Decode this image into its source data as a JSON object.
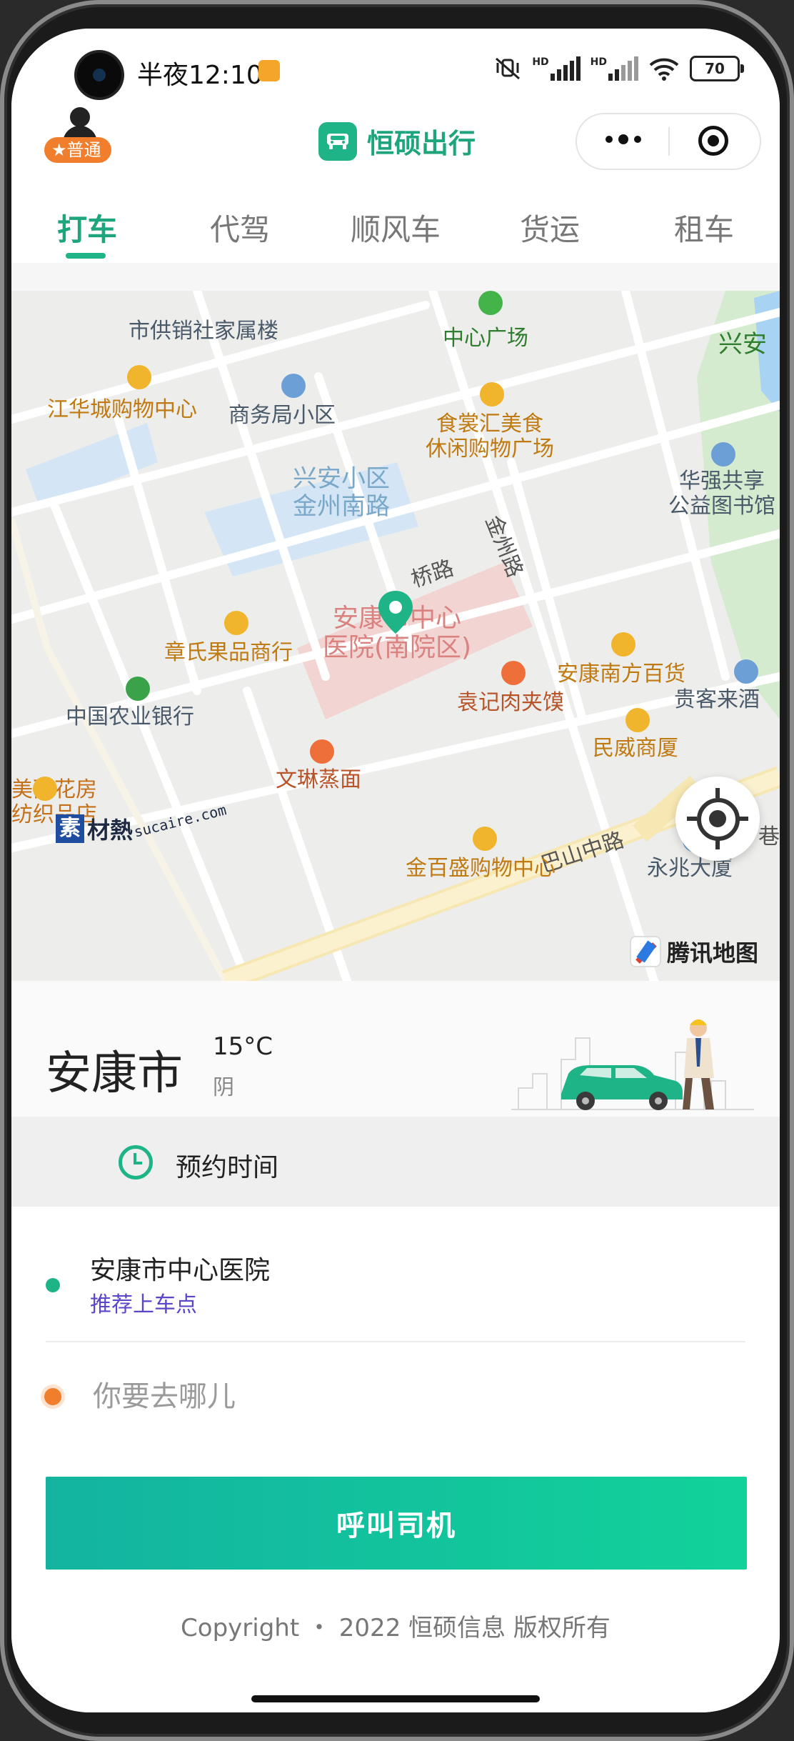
{
  "status_bar": {
    "time": "半夜12:10",
    "network_1": "HD",
    "network_2": "HD",
    "battery": "70",
    "icons": [
      "mute-vibrate-icon",
      "signal-icon",
      "signal-icon",
      "wifi-icon",
      "battery-icon"
    ]
  },
  "header": {
    "user_level": "★普通",
    "app_name": "恒硕出行",
    "more_icon": "more-dots-icon",
    "close_icon": "target-icon"
  },
  "tabs": [
    {
      "label": "打车",
      "active": true
    },
    {
      "label": "代驾",
      "active": false
    },
    {
      "label": "顺风车",
      "active": false
    },
    {
      "label": "货运",
      "active": false
    },
    {
      "label": "租车",
      "active": false
    }
  ],
  "map": {
    "pois": {
      "p1": "市供销社家属楼",
      "p2": "中心广场",
      "p3": "兴安",
      "p4": "江华城购物中心",
      "p5": "商务局小区",
      "p6": "食裳汇美食\n休闲购物广场",
      "p7": "华强共享\n公益图书馆",
      "p8": "兴安小区\n金州南路",
      "p9": "金州路",
      "p10": "桥路",
      "p11": "章氏果品商行",
      "p12": "安康市中心\n医院(南院区)",
      "p13": "安康南方百货",
      "p14": "贵客来酒",
      "p15": "中国农业银行",
      "p16": "袁记肉夹馍",
      "p17": "民威商厦",
      "p18": "美丽花房\n纺织品店",
      "p19": "文琳蒸面",
      "p20": "巴山中路",
      "p21": "金百盛购物中心",
      "p22": "永兆大厦",
      "p23": "巷"
    },
    "provider": "腾讯地图",
    "watermark_seal": "素",
    "watermark_text": "材熱",
    "watermark_url": "sucaire.com"
  },
  "weather": {
    "city": "安康市",
    "temperature": "15°C",
    "condition": "阴"
  },
  "booking": {
    "reserve_label": "预约时间",
    "pickup_title": "安康市中心医院",
    "pickup_sub": "推荐上车点",
    "destination_placeholder": "你要去哪儿",
    "call_button": "呼叫司机"
  },
  "footer": {
    "copyright": "Copyright ・ 2022 恒硕信息 版权所有"
  },
  "colors": {
    "brand": "#1fb487",
    "brand_dark": "#1fa57d",
    "accent_orange": "#f07e2c",
    "sub_link": "#5b46c9"
  }
}
